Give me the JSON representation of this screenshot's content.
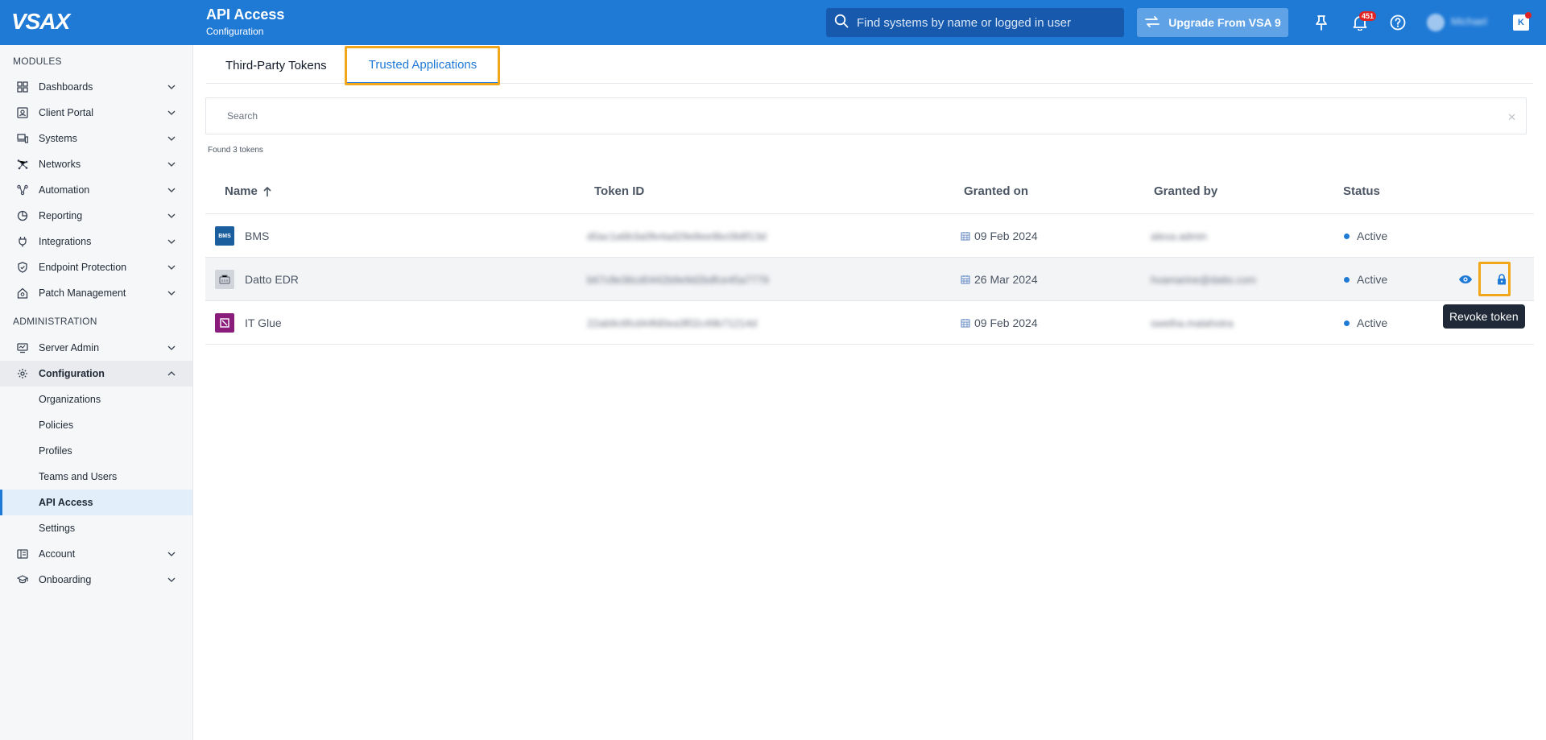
{
  "header": {
    "logo": "VSAX",
    "title": "API Access",
    "subtitle": "Configuration",
    "search_placeholder": "Find systems by name or logged in user",
    "upgrade_label": "Upgrade From VSA 9",
    "notification_count": "451",
    "user_name": "Michael",
    "collapse_label": "K"
  },
  "sidebar": {
    "modules_label": "MODULES",
    "modules": [
      {
        "label": "Dashboards",
        "icon": "dashboard-grid-icon"
      },
      {
        "label": "Client Portal",
        "icon": "client-portal-icon"
      },
      {
        "label": "Systems",
        "icon": "devices-icon"
      },
      {
        "label": "Networks",
        "icon": "network-icon"
      },
      {
        "label": "Automation",
        "icon": "automation-icon"
      },
      {
        "label": "Reporting",
        "icon": "reporting-icon"
      },
      {
        "label": "Integrations",
        "icon": "plug-icon"
      },
      {
        "label": "Endpoint Protection",
        "icon": "shield-icon"
      },
      {
        "label": "Patch Management",
        "icon": "patch-icon"
      }
    ],
    "admin_label": "ADMINISTRATION",
    "admin": [
      {
        "label": "Server Admin",
        "icon": "server-admin-icon"
      },
      {
        "label": "Configuration",
        "icon": "gear-icon"
      }
    ],
    "config_children": [
      "Organizations",
      "Policies",
      "Profiles",
      "Teams and Users",
      "API Access",
      "Settings"
    ],
    "bottom": [
      {
        "label": "Account",
        "icon": "account-icon"
      },
      {
        "label": "Onboarding",
        "icon": "onboarding-icon"
      }
    ]
  },
  "tabs": [
    "Third-Party Tokens",
    "Trusted Applications"
  ],
  "filter": {
    "placeholder": "Search"
  },
  "found_text": "Found 3 tokens",
  "table": {
    "columns": [
      "Name",
      "Token ID",
      "Granted on",
      "Granted by",
      "Status"
    ],
    "rows": [
      {
        "name": "BMS",
        "logo_text": "BMS",
        "logo_color": "#1b5e9e",
        "token_id": "d0ac1a6b3a0fe4ad29e8ee9bc0b8f13d",
        "granted_on": "09 Feb 2024",
        "granted_by": "alexa.admin",
        "status": "Active"
      },
      {
        "name": "Datto EDR",
        "logo_text": "",
        "logo_color": "#d1d5db",
        "token_id": "b67c8e36cd0442b9e9d2bdfce45a7779",
        "granted_on": "26 Mar 2024",
        "granted_by": "hvamarine@datto.com",
        "status": "Active"
      },
      {
        "name": "IT Glue",
        "logo_text": "",
        "logo_color": "#8a1c7c",
        "token_id": "22ab9c6fcd44fd0ea3f02c49b71214d",
        "granted_on": "09 Feb 2024",
        "granted_by": "swetha.malahotra",
        "status": "Active"
      }
    ]
  },
  "tooltip": "Revoke token",
  "colors": {
    "brand": "#1f7ad6",
    "highlight": "#f2a71b",
    "active": "#1f7ad6"
  }
}
